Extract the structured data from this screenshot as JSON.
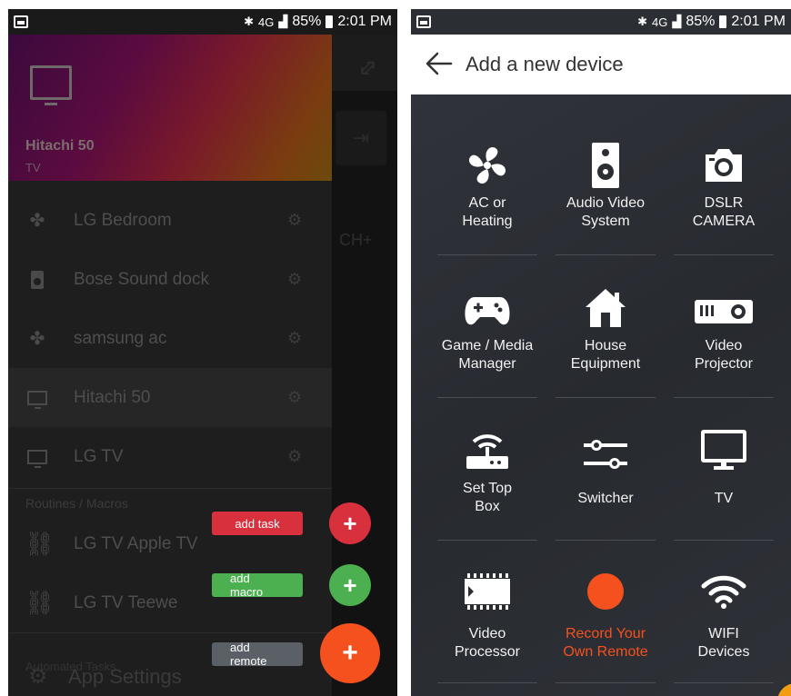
{
  "status_bar": {
    "battery": "85%",
    "time": "2:01 PM",
    "network": "4G"
  },
  "left": {
    "header": {
      "title": "Hitachi 50",
      "subtitle": "TV"
    },
    "background": {
      "channel_label": "CH+"
    },
    "devices": [
      {
        "label": "LG Bedroom",
        "icon": "fan-icon"
      },
      {
        "label": "Bose Sound dock",
        "icon": "speaker-icon"
      },
      {
        "label": "samsung ac",
        "icon": "fan-icon"
      },
      {
        "label": "Hitachi 50",
        "icon": "tv-icon",
        "active": true
      },
      {
        "label": "LG TV",
        "icon": "tv-icon"
      }
    ],
    "section_macros": "Routines / Macros",
    "macros": [
      {
        "label": "LG TV Apple TV",
        "icon": "link-icon"
      },
      {
        "label": "LG TV Teewe",
        "icon": "link-icon"
      }
    ],
    "section_other": "Automated Tasks",
    "settings_label": "App Settings",
    "fab": {
      "add_task": "add task",
      "add_macro": "add macro",
      "add_remote": "add remote",
      "plus": "+"
    },
    "colors": {
      "task": "#d9303e",
      "macro": "#4caf50",
      "remote": "#f4511e",
      "remote_label": "#5a6066"
    }
  },
  "right": {
    "title": "Add a new device",
    "tiles": [
      {
        "label": "AC or\nHeating",
        "icon": "fan-icon"
      },
      {
        "label": "Audio Video\nSystem",
        "icon": "speaker-icon"
      },
      {
        "label": "DSLR\nCAMERA",
        "icon": "camera-icon"
      },
      {
        "label": "Game / Media\nManager",
        "icon": "gamepad-icon"
      },
      {
        "label": "House\nEquipment",
        "icon": "house-icon"
      },
      {
        "label": "Video\nProjector",
        "icon": "projector-icon"
      },
      {
        "label": "Set Top\nBox",
        "icon": "router-icon"
      },
      {
        "label": "Switcher",
        "icon": "sliders-icon"
      },
      {
        "label": "TV",
        "icon": "tv-icon"
      },
      {
        "label": "Video\nProcessor",
        "icon": "chip-icon"
      },
      {
        "label": "Record Your\nOwn Remote",
        "icon": "record-icon"
      },
      {
        "label": "WIFI\nDevices",
        "icon": "wifi-icon"
      }
    ],
    "colors": {
      "record": "#f4511e"
    }
  }
}
